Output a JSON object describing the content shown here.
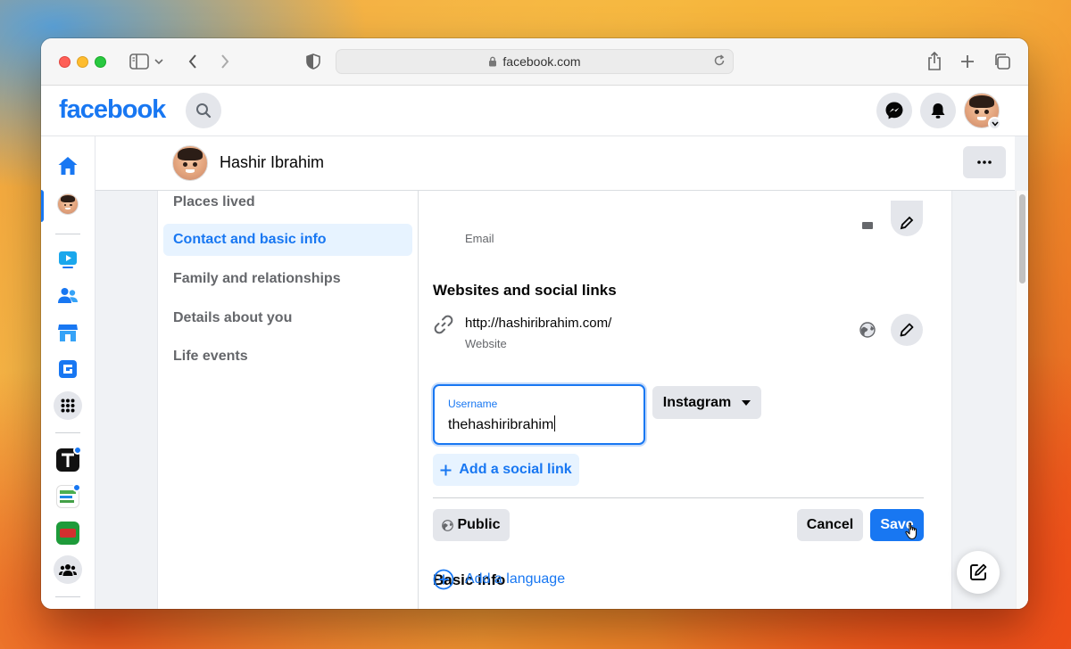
{
  "browser": {
    "url": "facebook.com"
  },
  "header": {
    "logo": "facebook"
  },
  "profile": {
    "name": "Hashir Ibrahim"
  },
  "about_nav": {
    "items": [
      {
        "label": "Places lived",
        "active": false
      },
      {
        "label": "Contact and basic info",
        "active": true
      },
      {
        "label": "Family and relationships",
        "active": false
      },
      {
        "label": "Details about you",
        "active": false
      },
      {
        "label": "Life events",
        "active": false
      }
    ]
  },
  "contact": {
    "email_label": "Email",
    "websites_title": "Websites and social links",
    "website_url": "http://hashiribrahim.com/",
    "website_label": "Website",
    "social_field": {
      "label": "Username",
      "value": "thehashiribrahim"
    },
    "social_network": "Instagram",
    "add_social_link": "Add a social link",
    "privacy": "Public",
    "cancel": "Cancel",
    "save": "Save",
    "basic_info_title": "Basic info",
    "add_language": "Add a language"
  },
  "colors": {
    "brand": "#1877f2",
    "accent_light": "#e7f3ff",
    "secondary_button": "#e4e6eb"
  }
}
